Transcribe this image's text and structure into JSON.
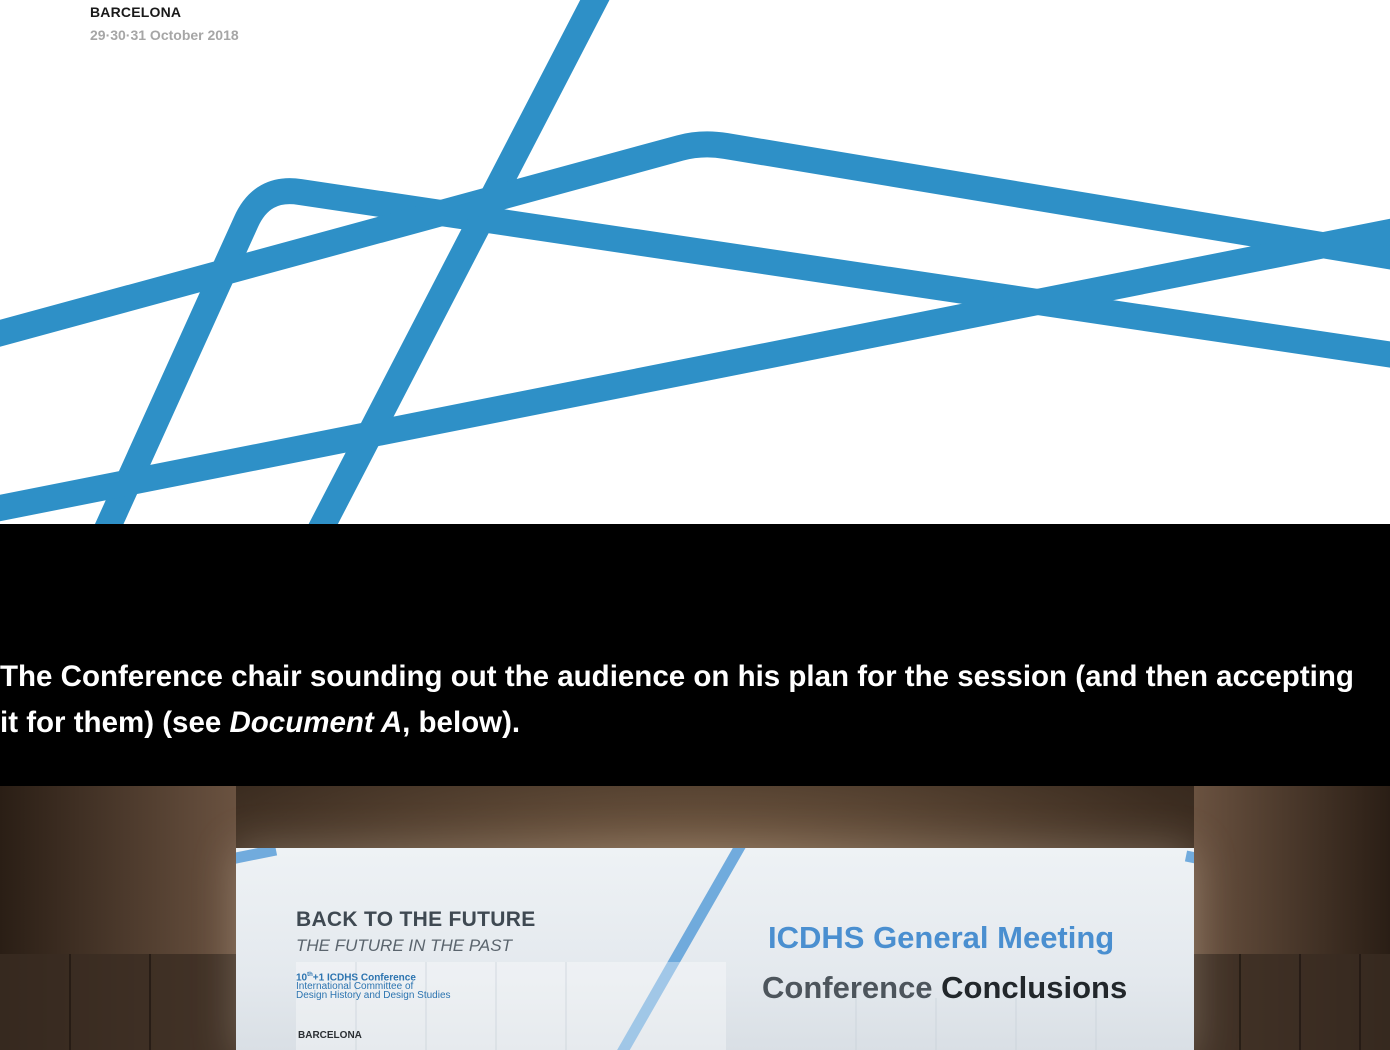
{
  "banner": {
    "city": "BARCELONA",
    "dates": "29·30·31 October 2018",
    "line_color": "#2e90c7"
  },
  "caption": {
    "part1": "The Conference chair sounding out the audience on his plan for the session (and then accepting it for them) (see ",
    "doc_ref": "Document A",
    "part2": ", below)."
  },
  "photo": {
    "screen": {
      "title": "BACK TO THE FUTURE",
      "subtitle": "THE FUTURE IN THE PAST",
      "conf_line1_num": "10",
      "conf_line1_sup": "th",
      "conf_line1_rest": "+1 ICDHS Conference",
      "conf_line2": "International Committee of",
      "conf_line3": "Design History and Design Studies",
      "city": "BARCELONA",
      "meeting": "ICDHS General Meeting",
      "conclusions_a": "Conference ",
      "conclusions_b": "Conclusions"
    }
  },
  "colors": {
    "accent_blue": "#2e90c7",
    "caption_bg": "#000000",
    "caption_text": "#ffffff"
  }
}
